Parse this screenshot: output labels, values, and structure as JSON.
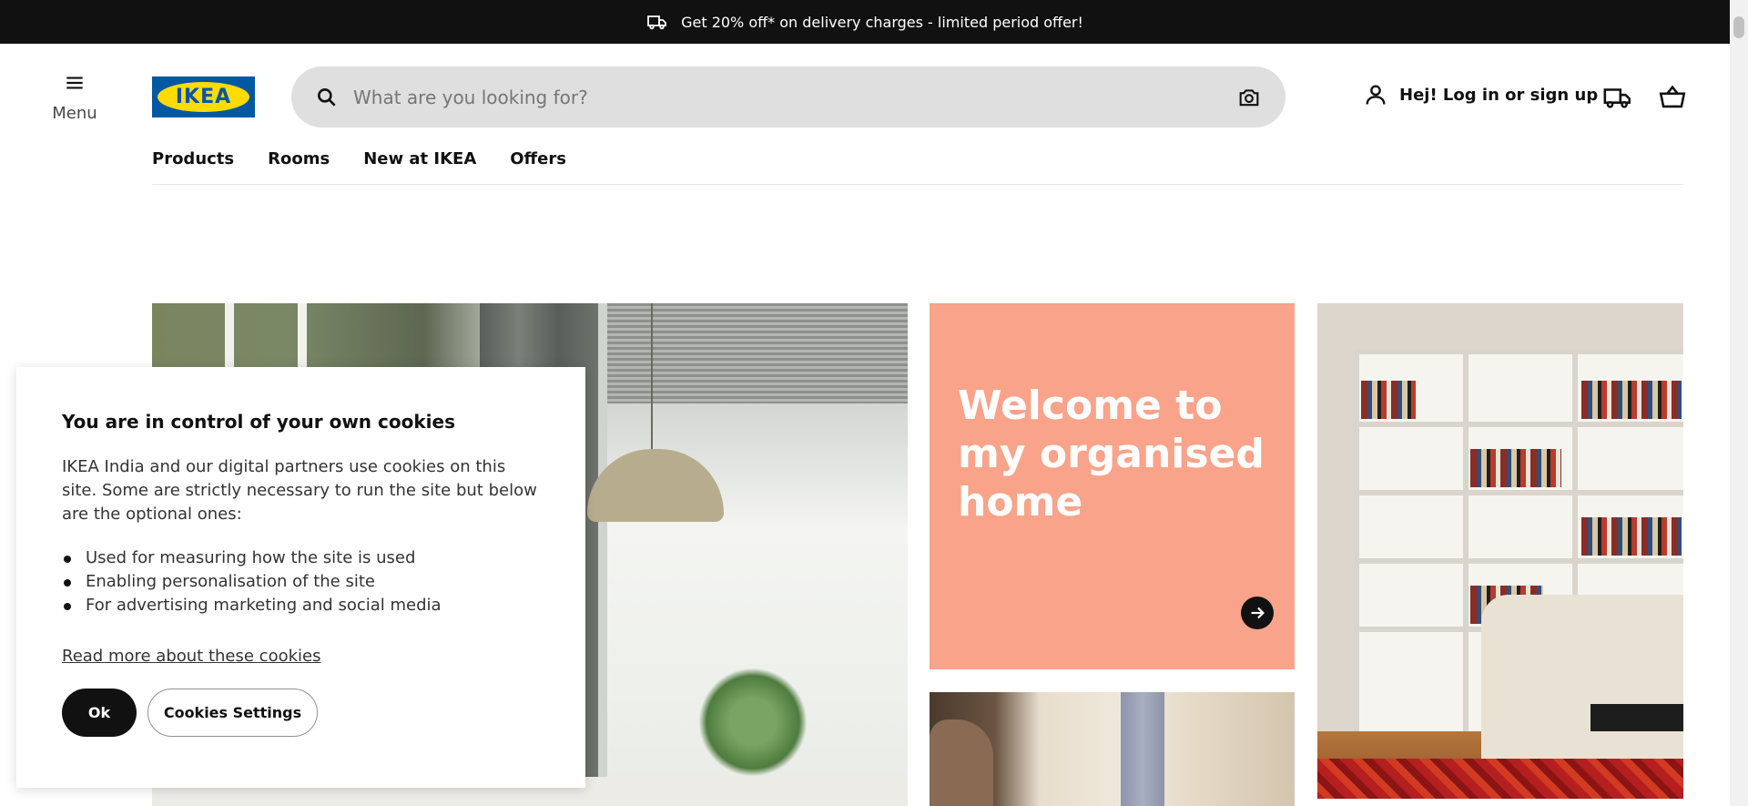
{
  "promo": {
    "text": "Get 20% off* on delivery charges - limited period offer!",
    "icon": "delivery-truck-icon"
  },
  "header": {
    "menu_label": "Menu",
    "logo_text": "IKEA",
    "search": {
      "placeholder": "What are you looking for?",
      "value": ""
    },
    "account_label": "Hej! Log in or sign up"
  },
  "nav": {
    "items": [
      "Products",
      "Rooms",
      "New at IKEA",
      "Offers"
    ]
  },
  "welcome_card": {
    "title": "Welcome to my organised home"
  },
  "cookies": {
    "title": "You are in control of your own cookies",
    "body": "IKEA India and our digital partners use cookies on this site. Some are strictly necessary to run the site but below are the optional ones:",
    "items": [
      "Used for measuring how the site is used",
      "Enabling personalisation of the site",
      "For advertising marketing and social media"
    ],
    "read_more": "Read more about these cookies",
    "ok_label": "Ok",
    "settings_label": "Cookies Settings"
  },
  "colors": {
    "promo_bg": "#111111",
    "welcome_bg": "#f8a38a",
    "logo_blue": "#0058a3",
    "logo_yellow": "#ffdb00",
    "search_bg": "#dfdfdf"
  }
}
